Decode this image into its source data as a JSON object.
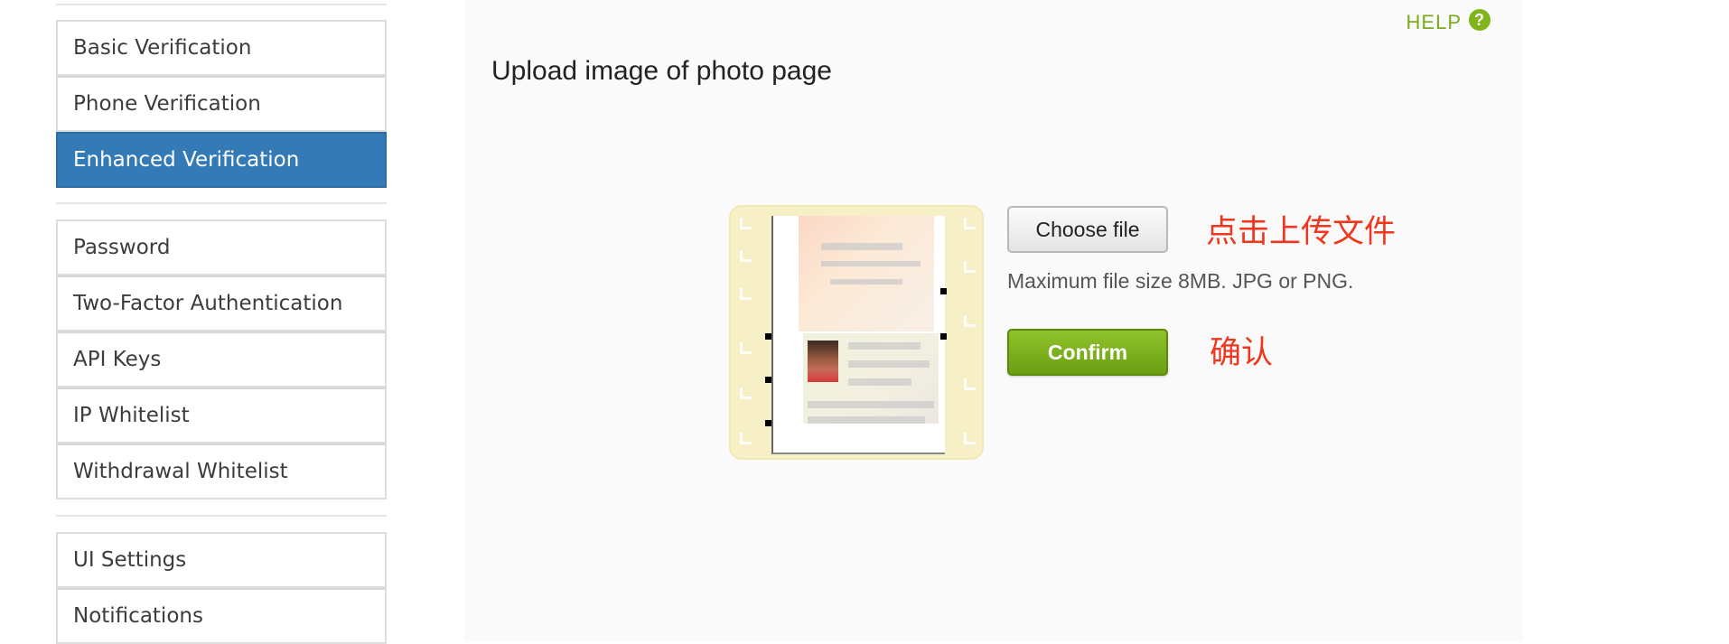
{
  "sidebar": {
    "groups": [
      {
        "items": [
          {
            "label": "Basic Verification",
            "active": false
          },
          {
            "label": "Phone Verification",
            "active": false
          },
          {
            "label": "Enhanced Verification",
            "active": true
          }
        ]
      },
      {
        "items": [
          {
            "label": "Password",
            "active": false
          },
          {
            "label": "Two-Factor Authentication",
            "active": false
          },
          {
            "label": "API Keys",
            "active": false
          },
          {
            "label": "IP Whitelist",
            "active": false
          },
          {
            "label": "Withdrawal Whitelist",
            "active": false
          }
        ]
      },
      {
        "items": [
          {
            "label": "UI Settings",
            "active": false
          },
          {
            "label": "Notifications",
            "active": false
          }
        ]
      }
    ]
  },
  "main": {
    "help_label": "HELP",
    "help_icon": "question-circle-icon",
    "title": "Upload image of photo page",
    "choose_file_label": "Choose file",
    "file_hint": "Maximum file size 8MB. JPG or PNG.",
    "confirm_label": "Confirm",
    "annotations": {
      "upload": "点击上传文件",
      "confirm": "确认"
    }
  },
  "colors": {
    "active_sidebar": "#337ab7",
    "accent_green": "#7fb51b",
    "annotation_red": "#f0371e"
  }
}
